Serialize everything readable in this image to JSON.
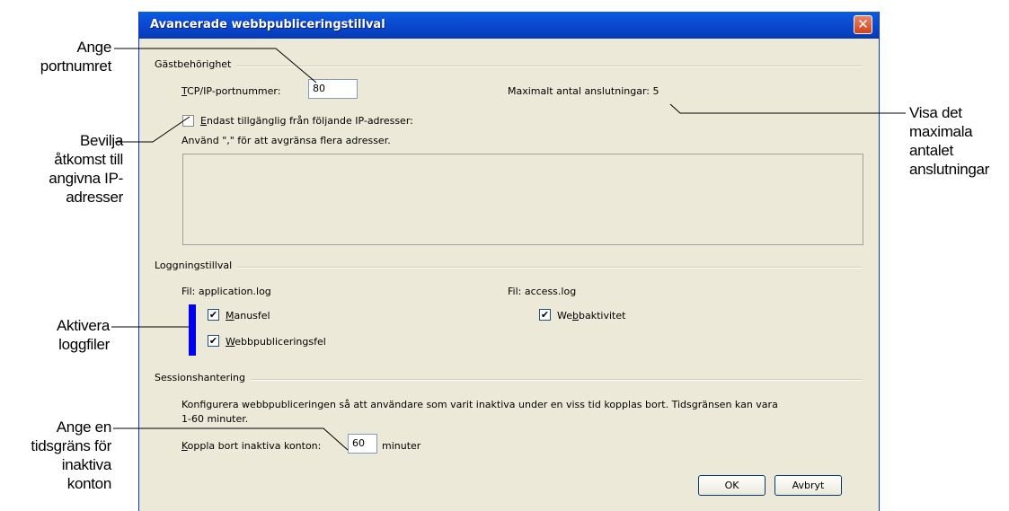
{
  "dialog": {
    "title": "Avancerade webbpubliceringstillval",
    "close_symbol": "✕"
  },
  "guest": {
    "group_title": "Gästbehörighet",
    "port_label_u": "T",
    "port_label_rest": "CP/IP-portnummer:",
    "port_value": "80",
    "max_connections_label": "Maximalt antal anslutningar: 5",
    "ip_checkbox_checked": false,
    "ip_label_u": "E",
    "ip_label_rest": "ndast tillgänglig från följande IP-adresser:",
    "ip_hint": "Använd \",\" för att avgränsa flera adresser.",
    "ip_addresses_value": ""
  },
  "logging": {
    "group_title": "Loggningstillval",
    "app_file_label": "Fil: application.log",
    "access_file_label": "Fil: access.log",
    "script_errors_checked": true,
    "script_errors_u": "M",
    "script_errors_rest": "anusfel",
    "publish_errors_checked": true,
    "publish_errors_u": "W",
    "publish_errors_rest": "ebbpubliceringsfel",
    "web_activity_checked": true,
    "web_activity_pre": "We",
    "web_activity_u": "b",
    "web_activity_rest": "baktivitet"
  },
  "session": {
    "group_title": "Sessionshantering",
    "description_line1": "Konfigurera webbpubliceringen så att användare som varit inaktiva under en viss tid kopplas bort.  Tidsgränsen kan vara",
    "description_line2": "1-60 minuter.",
    "timeout_label_u": "K",
    "timeout_label_rest": "oppla bort inaktiva konton:",
    "timeout_value": "60",
    "timeout_unit": "minuter"
  },
  "buttons": {
    "ok": "OK",
    "cancel": "Avbryt"
  },
  "check_symbol": "✔",
  "callouts": {
    "port": [
      "Ange",
      "portnumret"
    ],
    "ip": [
      "Bevilja",
      "åtkomst till",
      "angivna IP-",
      "adresser"
    ],
    "logs": [
      "Aktivera",
      "loggfiler"
    ],
    "timeout": [
      "Ange en",
      "tidsgräns för",
      "inaktiva",
      "konton"
    ],
    "max": [
      "Visa det",
      "maximala",
      "antalet",
      "anslutningar"
    ]
  },
  "colors": {
    "titlebar": "#0842c6",
    "dialog_bg": "#ece9d8",
    "close_button": "#d0421b",
    "highlight_bar": "#0000ee"
  }
}
